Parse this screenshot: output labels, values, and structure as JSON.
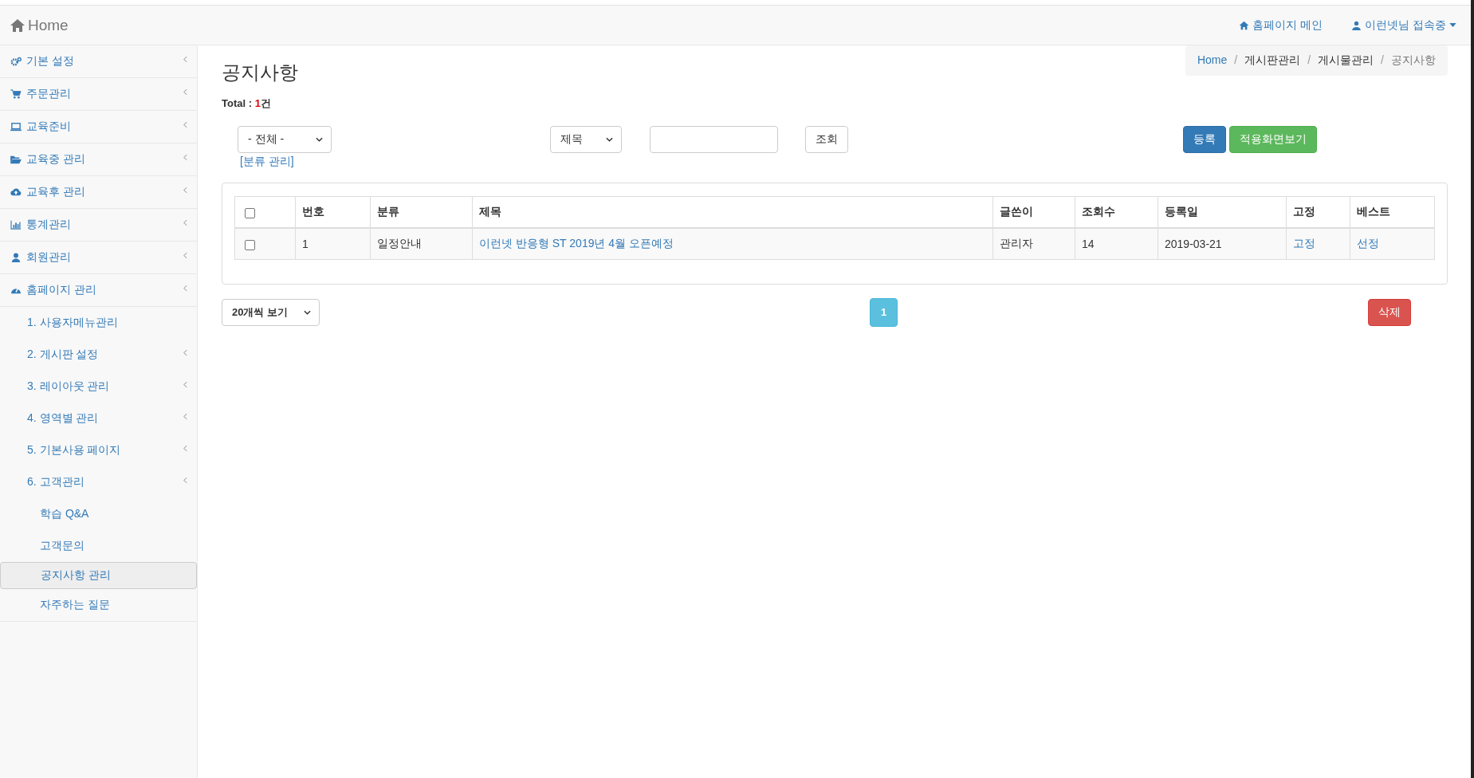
{
  "topbar": {
    "brand": "Home",
    "links": [
      {
        "kind": "home",
        "label": "홈페이지 메인"
      },
      {
        "kind": "user",
        "label": "이런넷님 접속중"
      }
    ]
  },
  "sidebar": {
    "items": [
      {
        "label": "기본 설정",
        "kind": "submenu",
        "selected": false
      },
      {
        "label": "주문관리",
        "kind": "submenu",
        "selected": false
      },
      {
        "label": "교육준비",
        "kind": "submenu",
        "selected": false
      },
      {
        "label": "교육중 관리",
        "kind": "submenu",
        "selected": false
      },
      {
        "label": "교육후 관리",
        "kind": "submenu",
        "selected": false
      },
      {
        "label": "통계관리",
        "kind": "submenu",
        "selected": false
      },
      {
        "label": "회원관리",
        "kind": "submenu",
        "selected": false
      },
      {
        "label": "홈페이지 관리",
        "kind": "submenu",
        "selected": false,
        "children": [
          {
            "label": "1. 사용자메뉴관리",
            "kind": "link",
            "selected": false
          },
          {
            "label": "2. 게시판 설정",
            "kind": "submenu",
            "selected": false
          },
          {
            "label": "3. 레이아웃 관리",
            "kind": "submenu",
            "selected": false
          },
          {
            "label": "4. 영역별 관리",
            "kind": "submenu",
            "selected": false
          },
          {
            "label": "5. 기본사용 페이지",
            "kind": "submenu",
            "selected": false
          },
          {
            "label": "6. 고객관리",
            "kind": "submenu",
            "selected": false,
            "children": [
              {
                "label": "학습 Q&A",
                "selected": false
              },
              {
                "label": "고객문의",
                "selected": false
              },
              {
                "label": "공지사항 관리",
                "selected": true
              },
              {
                "label": "자주하는 질문",
                "selected": false
              }
            ]
          }
        ]
      }
    ]
  },
  "breadcrumb_separator": "/",
  "breadcrumb": [
    {
      "label": "Home",
      "kind": "link"
    },
    {
      "label": "게시판관리",
      "kind": "text"
    },
    {
      "label": "게시물관리",
      "kind": "text"
    },
    {
      "label": "공지사항",
      "kind": "current"
    }
  ],
  "page_title": "공지사항",
  "total": {
    "label": "Total :",
    "count": "1",
    "unit": "건"
  },
  "filters": {
    "category": "- 전체 -",
    "category_link": "[분류 관리]",
    "field": "제목",
    "search_button": "조회"
  },
  "actions": {
    "register": "등록",
    "preview": "적용화면보기"
  },
  "table": {
    "header_checked": false,
    "columns": [
      "번호",
      "분류",
      "제목",
      "글쓴이",
      "조회수",
      "등록일",
      "고정",
      "베스트"
    ],
    "rows": [
      {
        "checked": false,
        "number": "1",
        "category": "일정안내",
        "title": "이런넷 반응형 ST 2019년 4월 오픈예정",
        "author": "관리자",
        "views": "14",
        "date": "2019-03-21",
        "pinned": "고정",
        "best": "선정"
      }
    ]
  },
  "page_size": "20개씩 보기",
  "pagination": [
    {
      "label": "1",
      "selected": true
    }
  ],
  "delete_button": "삭제"
}
